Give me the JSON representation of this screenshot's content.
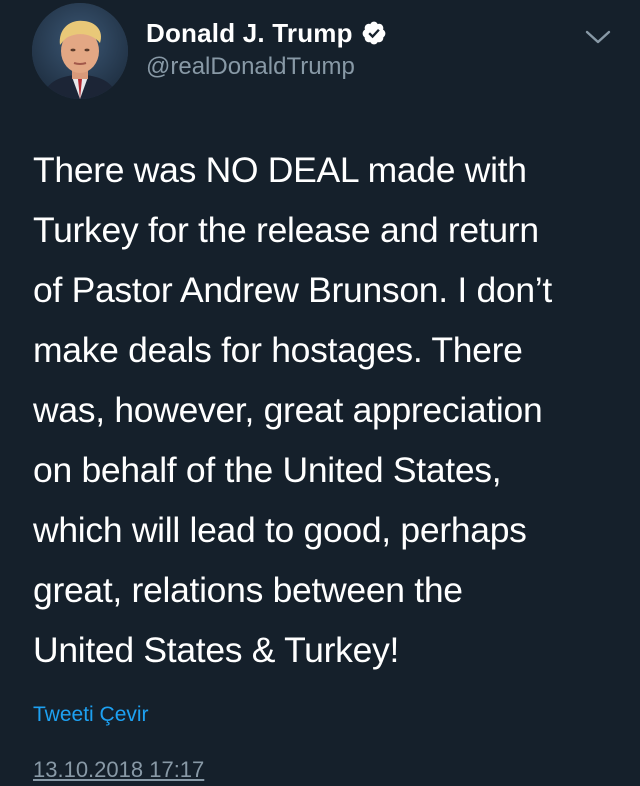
{
  "author": {
    "display_name": "Donald J. Trump",
    "handle": "@realDonaldTrump",
    "verified": true,
    "avatar_icon": "profile-photo-icon"
  },
  "tweet": {
    "lines": [
      "There was NO DEAL made with",
      "Turkey for the release and return",
      "of Pastor Andrew Brunson. I don’t",
      "make deals for hostages. There",
      "was, however, great appreciation",
      "on behalf of the United States,",
      "which will lead to good, perhaps",
      "great, relations between the",
      "United States & Turkey!"
    ],
    "translate_label": "Tweeti Çevir",
    "timestamp": "13.10.2018 17:17"
  },
  "icons": {
    "verified": "verified-badge-icon",
    "menu": "chevron-down-icon"
  },
  "colors": {
    "background": "#15202b",
    "text": "#ffffff",
    "muted": "#8899a6",
    "accent": "#1da1f2"
  }
}
